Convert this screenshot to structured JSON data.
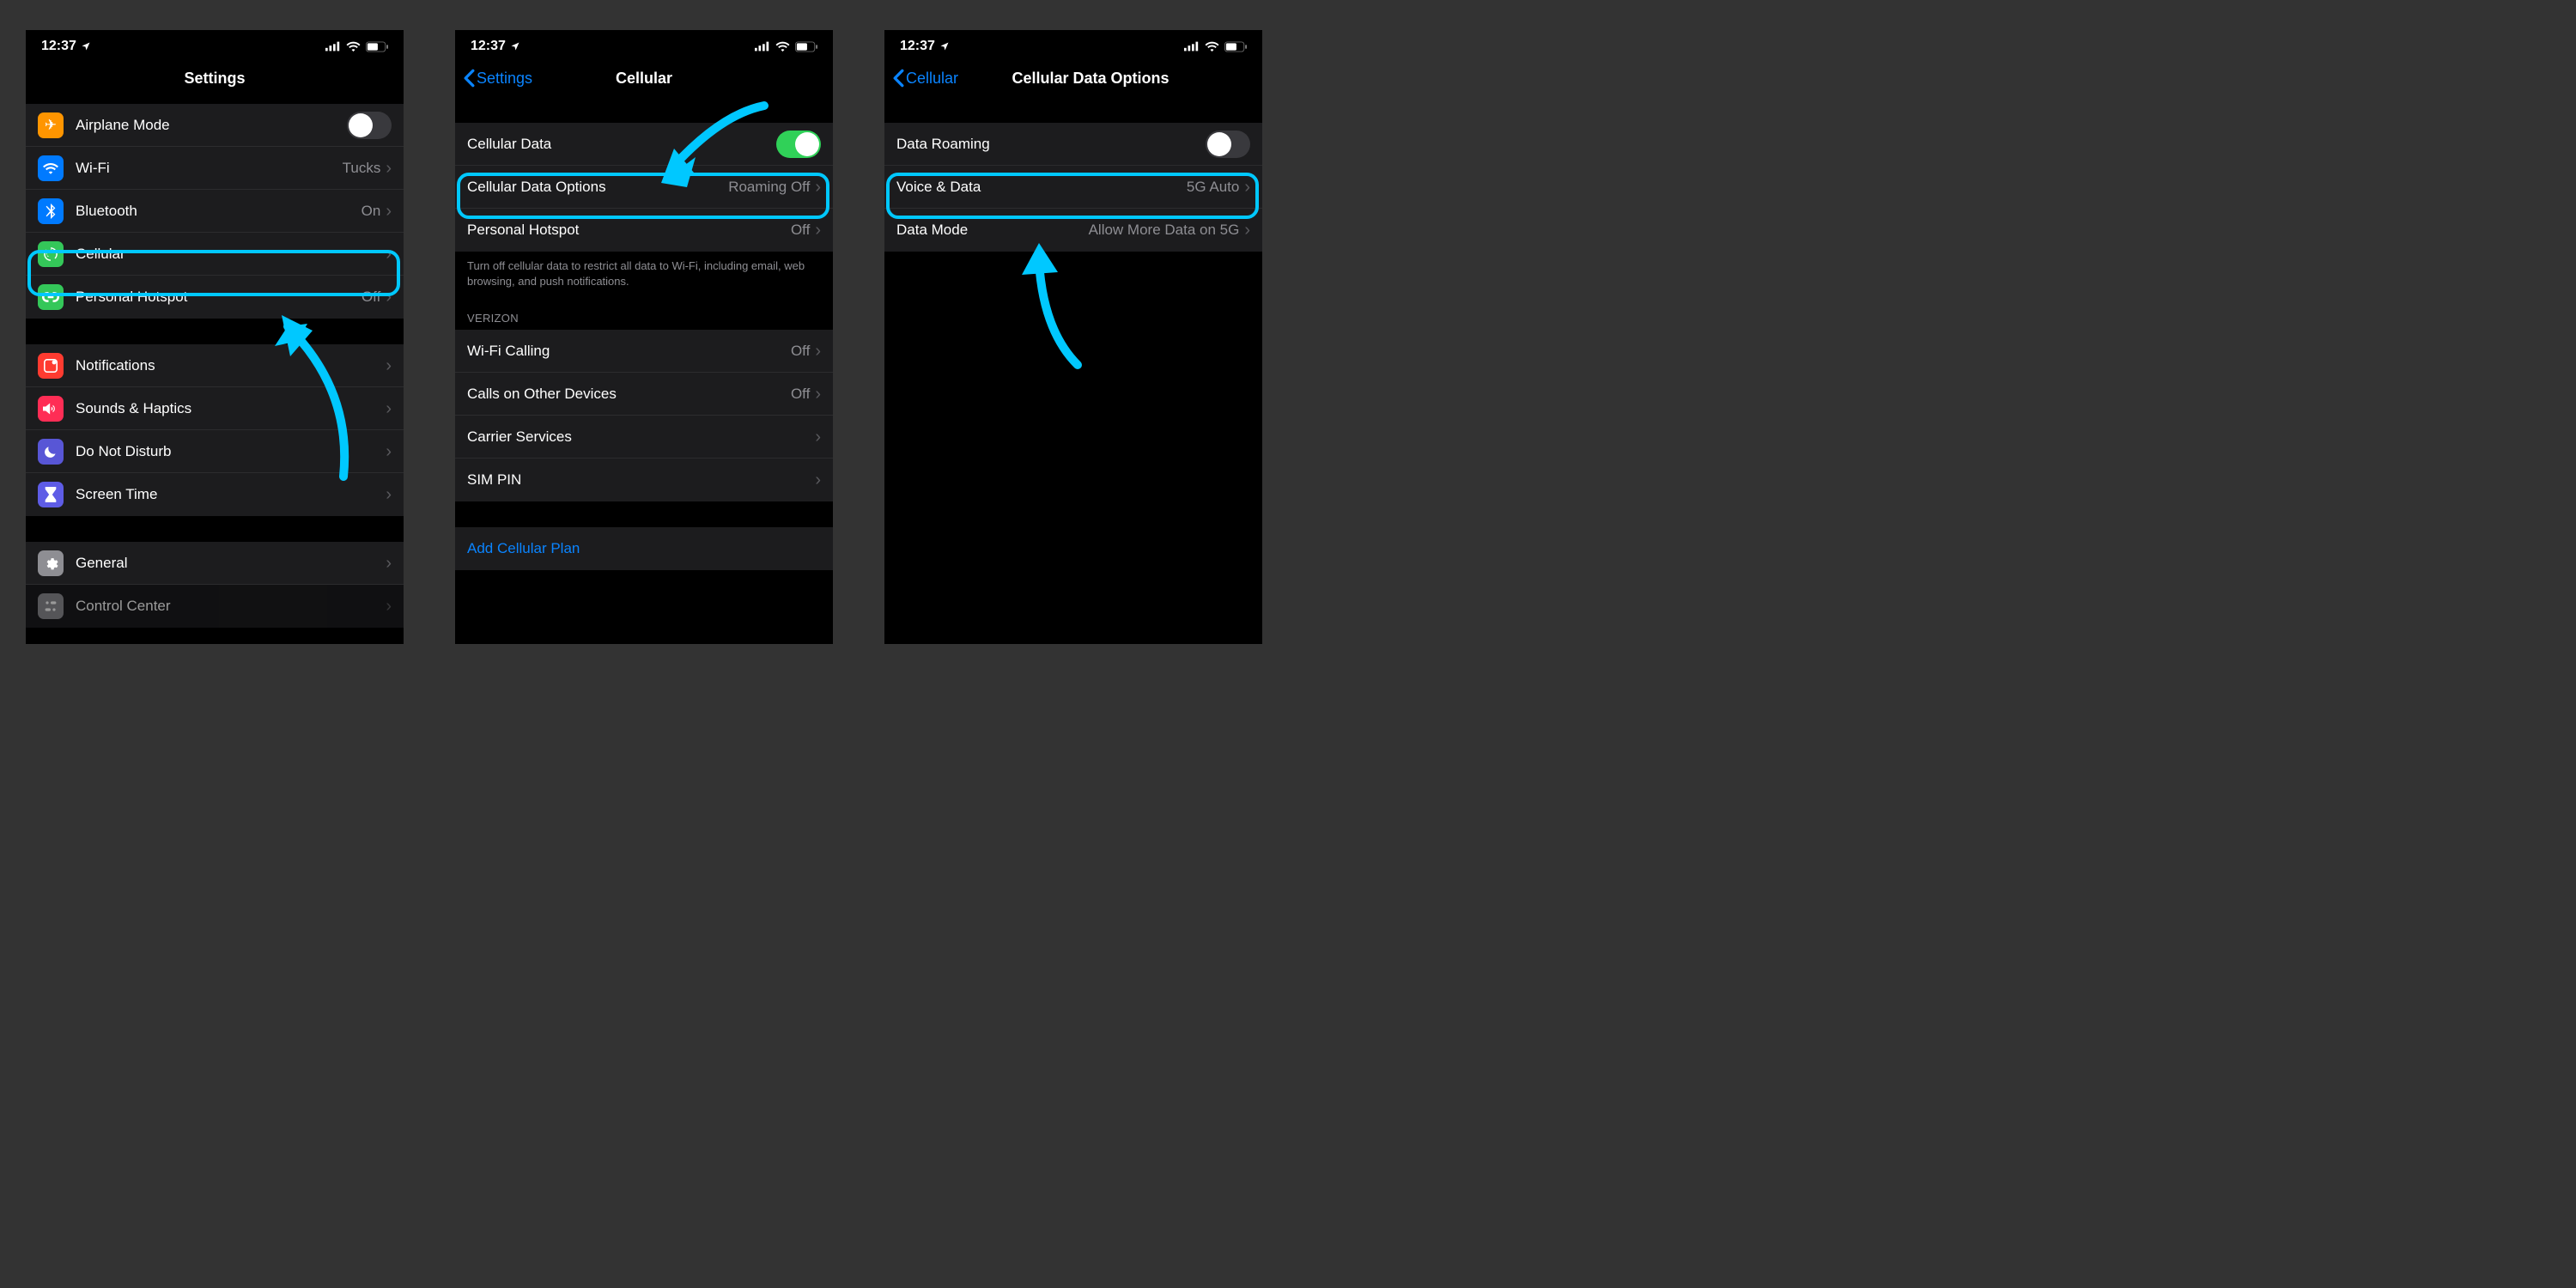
{
  "statusbar": {
    "time": "12:37"
  },
  "s1": {
    "title": "Settings",
    "rows": {
      "airplane": "Airplane Mode",
      "wifi": {
        "label": "Wi-Fi",
        "value": "Tucks"
      },
      "bluetooth": {
        "label": "Bluetooth",
        "value": "On"
      },
      "cellular": "Cellular",
      "hotspot": {
        "label": "Personal Hotspot",
        "value": "Off"
      },
      "notifications": "Notifications",
      "sounds": "Sounds & Haptics",
      "dnd": "Do Not Disturb",
      "screentime": "Screen Time",
      "general": "General",
      "controlcenter": "Control Center"
    }
  },
  "s2": {
    "back": "Settings",
    "title": "Cellular",
    "rows": {
      "cellular_data": "Cellular Data",
      "cellular_data_options": {
        "label": "Cellular Data Options",
        "value": "Roaming Off"
      },
      "hotspot": {
        "label": "Personal Hotspot",
        "value": "Off"
      },
      "footer": "Turn off cellular data to restrict all data to Wi-Fi, including email, web browsing, and push notifications.",
      "carrier_header": "VERIZON",
      "wifi_calling": {
        "label": "Wi-Fi Calling",
        "value": "Off"
      },
      "calls_other": {
        "label": "Calls on Other Devices",
        "value": "Off"
      },
      "carrier_services": "Carrier Services",
      "sim_pin": "SIM PIN",
      "add_plan": "Add Cellular Plan"
    }
  },
  "s3": {
    "back": "Cellular",
    "title": "Cellular Data Options",
    "rows": {
      "data_roaming": "Data Roaming",
      "voice_data": {
        "label": "Voice & Data",
        "value": "5G Auto"
      },
      "data_mode": {
        "label": "Data Mode",
        "value": "Allow More Data on 5G"
      }
    }
  }
}
